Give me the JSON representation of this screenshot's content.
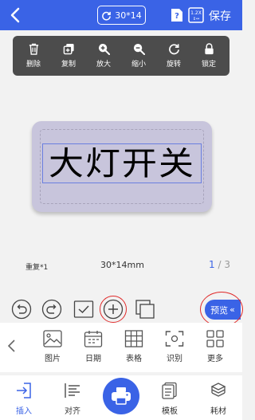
{
  "header": {
    "size_label": "30*14",
    "save_label": "保存",
    "icons": [
      "back-icon",
      "rotate-icon",
      "help-icon",
      "resize-icon"
    ]
  },
  "edit_toolbar": {
    "items": [
      {
        "label": "删除",
        "icon": "trash-icon"
      },
      {
        "label": "复制",
        "icon": "copy-icon"
      },
      {
        "label": "放大",
        "icon": "zoom-in-icon"
      },
      {
        "label": "缩小",
        "icon": "zoom-out-icon"
      },
      {
        "label": "旋转",
        "icon": "rotate-icon"
      },
      {
        "label": "锁定",
        "icon": "lock-icon"
      }
    ]
  },
  "canvas": {
    "label_text": "大灯开关",
    "label_color": "#c8c5dc"
  },
  "info": {
    "repeat": "重复*1",
    "dimension": "30*14mm",
    "current_page": "1",
    "page_separator": "/",
    "total_pages": "3"
  },
  "actions": {
    "preview_label": "预览",
    "preview_chevron": "«",
    "icons": [
      "undo-icon",
      "redo-icon",
      "select-icon",
      "add-icon",
      "layers-icon"
    ]
  },
  "insert_panel": {
    "items": [
      {
        "label": "图片",
        "icon": "image-icon"
      },
      {
        "label": "日期",
        "icon": "calendar-icon"
      },
      {
        "label": "表格",
        "icon": "table-icon"
      },
      {
        "label": "识别",
        "icon": "scan-icon"
      },
      {
        "label": "更多",
        "icon": "more-icon"
      }
    ]
  },
  "bottom_nav": {
    "items": [
      {
        "label": "插入",
        "icon": "insert-icon",
        "active": true
      },
      {
        "label": "对齐",
        "icon": "align-icon",
        "active": false
      },
      {
        "label": "模板",
        "icon": "template-icon",
        "active": false
      },
      {
        "label": "耗材",
        "icon": "consumables-icon",
        "active": false
      }
    ]
  },
  "colors": {
    "accent": "#3a63e6",
    "toolbar": "#4c4c4c",
    "highlight": "#e02a2a"
  }
}
